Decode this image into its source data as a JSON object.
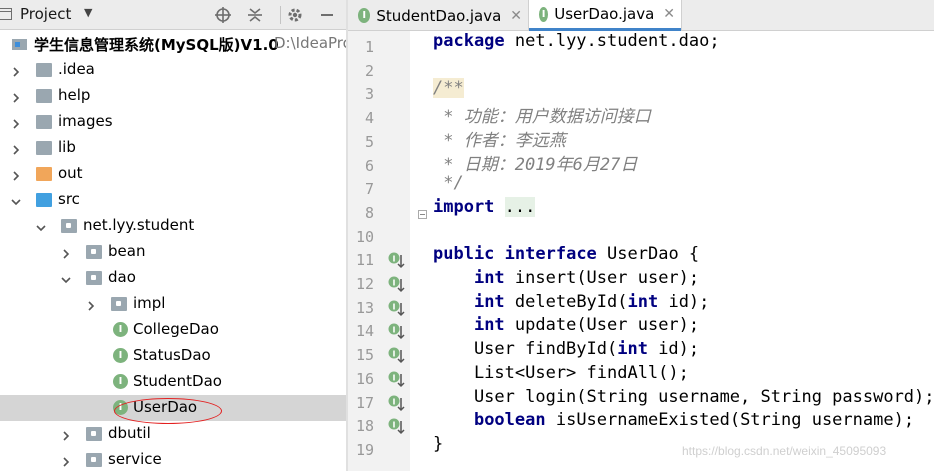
{
  "project_panel": {
    "title": "Project",
    "tree": [
      {
        "label": "学生信息管理系统(MySQL版)V1.0",
        "path": "D:\\IdeaPro",
        "depth": 0,
        "arrow": "none",
        "icon": "module",
        "bold": true
      },
      {
        "label": ".idea",
        "depth": 1,
        "arrow": "right",
        "icon": "folder-gray"
      },
      {
        "label": "help",
        "depth": 1,
        "arrow": "right",
        "icon": "folder-gray"
      },
      {
        "label": "images",
        "depth": 1,
        "arrow": "right",
        "icon": "folder-gray"
      },
      {
        "label": "lib",
        "depth": 1,
        "arrow": "right",
        "icon": "folder-gray"
      },
      {
        "label": "out",
        "depth": 1,
        "arrow": "right",
        "icon": "folder-orange"
      },
      {
        "label": "src",
        "depth": 1,
        "arrow": "down",
        "icon": "folder-blue"
      },
      {
        "label": "net.lyy.student",
        "depth": 2,
        "arrow": "down",
        "icon": "package"
      },
      {
        "label": "bean",
        "depth": 3,
        "arrow": "right",
        "icon": "package"
      },
      {
        "label": "dao",
        "depth": 3,
        "arrow": "down",
        "icon": "package"
      },
      {
        "label": "impl",
        "depth": 4,
        "arrow": "right",
        "icon": "package"
      },
      {
        "label": "CollegeDao",
        "depth": 4,
        "arrow": "none",
        "icon": "interface"
      },
      {
        "label": "StatusDao",
        "depth": 4,
        "arrow": "none",
        "icon": "interface"
      },
      {
        "label": "StudentDao",
        "depth": 4,
        "arrow": "none",
        "icon": "interface"
      },
      {
        "label": "UserDao",
        "depth": 4,
        "arrow": "none",
        "icon": "interface",
        "selected": true
      },
      {
        "label": "dbutil",
        "depth": 3,
        "arrow": "right",
        "icon": "package"
      },
      {
        "label": "service",
        "depth": 3,
        "arrow": "right",
        "icon": "package"
      }
    ]
  },
  "editor": {
    "tabs": [
      {
        "label": "StudentDao.java",
        "active": false,
        "icon": "interface-icon"
      },
      {
        "label": "UserDao.java",
        "active": true,
        "icon": "interface-icon"
      }
    ],
    "line_numbers": [
      "1",
      "2",
      "3",
      "4",
      "5",
      "6",
      "7",
      "8",
      "10",
      "11",
      "12",
      "13",
      "14",
      "15",
      "16",
      "17",
      "18",
      "19"
    ],
    "code_lines": [
      [
        {
          "t": "package",
          "c": "kw"
        },
        {
          "t": " net.lyy.student.dao;",
          "c": ""
        }
      ],
      [],
      [
        {
          "t": "/**",
          "c": "cm cmhl"
        }
      ],
      [
        {
          "t": " * 功能：用户数据访问接口",
          "c": "cm"
        }
      ],
      [
        {
          "t": " * 作者：李远燕",
          "c": "cm"
        }
      ],
      [
        {
          "t": " * 日期：2019年6月27日",
          "c": "cm"
        }
      ],
      [
        {
          "t": " */",
          "c": "cm"
        }
      ],
      [
        {
          "t": "import",
          "c": "kw"
        },
        {
          "t": " ",
          "c": ""
        },
        {
          "t": "...",
          "c": "fhl"
        }
      ],
      [],
      [
        {
          "t": "public",
          "c": "kw"
        },
        {
          "t": " ",
          "c": ""
        },
        {
          "t": "interface",
          "c": "kw"
        },
        {
          "t": " UserDao {",
          "c": ""
        }
      ],
      [
        {
          "t": "    ",
          "c": ""
        },
        {
          "t": "int",
          "c": "kw"
        },
        {
          "t": " insert(User user);",
          "c": ""
        }
      ],
      [
        {
          "t": "    ",
          "c": ""
        },
        {
          "t": "int",
          "c": "kw"
        },
        {
          "t": " deleteById(",
          "c": ""
        },
        {
          "t": "int",
          "c": "kw"
        },
        {
          "t": " id);",
          "c": ""
        }
      ],
      [
        {
          "t": "    ",
          "c": ""
        },
        {
          "t": "int",
          "c": "kw"
        },
        {
          "t": " update(User user);",
          "c": ""
        }
      ],
      [
        {
          "t": "    User findById(",
          "c": ""
        },
        {
          "t": "int",
          "c": "kw"
        },
        {
          "t": " id);",
          "c": ""
        }
      ],
      [
        {
          "t": "    List<User> findAll();",
          "c": ""
        }
      ],
      [
        {
          "t": "    User login(String username, String password);",
          "c": ""
        }
      ],
      [
        {
          "t": "    ",
          "c": ""
        },
        {
          "t": "boolean",
          "c": "kw"
        },
        {
          "t": " isUsernameExisted(String username);",
          "c": ""
        }
      ],
      [
        {
          "t": "}",
          "c": ""
        }
      ]
    ],
    "implementation_marker_lines": [
      "11",
      "12",
      "13",
      "14",
      "15",
      "16",
      "17",
      "18"
    ]
  },
  "watermark": "https://blog.csdn.net/weixin_45095093",
  "colors": {
    "keyword": "#000080",
    "comment": "#808080",
    "selection": "#d5d5d5",
    "annotation": "#e32020",
    "interface": "#7db37d"
  }
}
